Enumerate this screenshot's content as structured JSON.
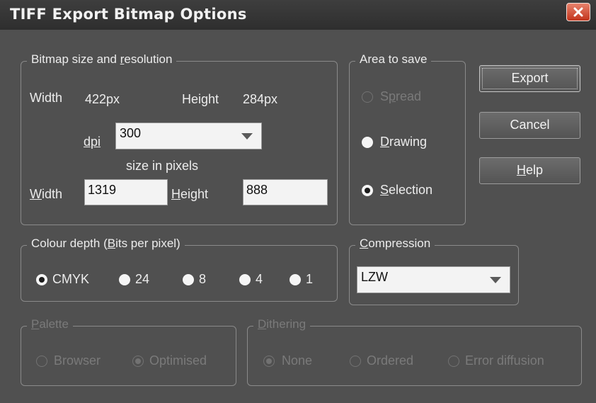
{
  "window": {
    "title": "TIFF Export Bitmap Options"
  },
  "bitmap": {
    "legend_pre": "Bitmap size and ",
    "legend_acc": "r",
    "legend_post": "esolution",
    "width_label": "Width",
    "width_value": "422px",
    "height_label": "Height",
    "height_value": "284px",
    "dpi_label": "dpi",
    "dpi_value": "300",
    "size_label": "size in pixels",
    "pixel_width_acc": "W",
    "pixel_width_rest": "idth",
    "pixel_width_value": "1319",
    "pixel_height_acc": "H",
    "pixel_height_rest": "eight",
    "pixel_height_value": "888"
  },
  "area": {
    "legend": "Area to save",
    "spread_pre": "S",
    "spread_acc": "p",
    "spread_post": "read",
    "drawing_acc": "D",
    "drawing_post": "rawing",
    "selection_acc": "S",
    "selection_post": "election"
  },
  "buttons": {
    "export": "Export",
    "cancel": "Cancel",
    "help_acc": "H",
    "help_post": "elp"
  },
  "colour": {
    "legend_pre": "Colour depth (",
    "legend_acc": "B",
    "legend_post": "its per pixel)",
    "options": [
      "CMYK",
      "24",
      "8",
      "4",
      "1"
    ]
  },
  "compression": {
    "legend_acc": "C",
    "legend_post": "ompression",
    "value": "LZW"
  },
  "palette": {
    "legend_acc": "P",
    "legend_post": "alette",
    "browser": "Browser",
    "optimised": "Optimised"
  },
  "dithering": {
    "legend_acc": "D",
    "legend_post": "ithering",
    "none": "None",
    "ordered": "Ordered",
    "error": "Error diffusion"
  }
}
